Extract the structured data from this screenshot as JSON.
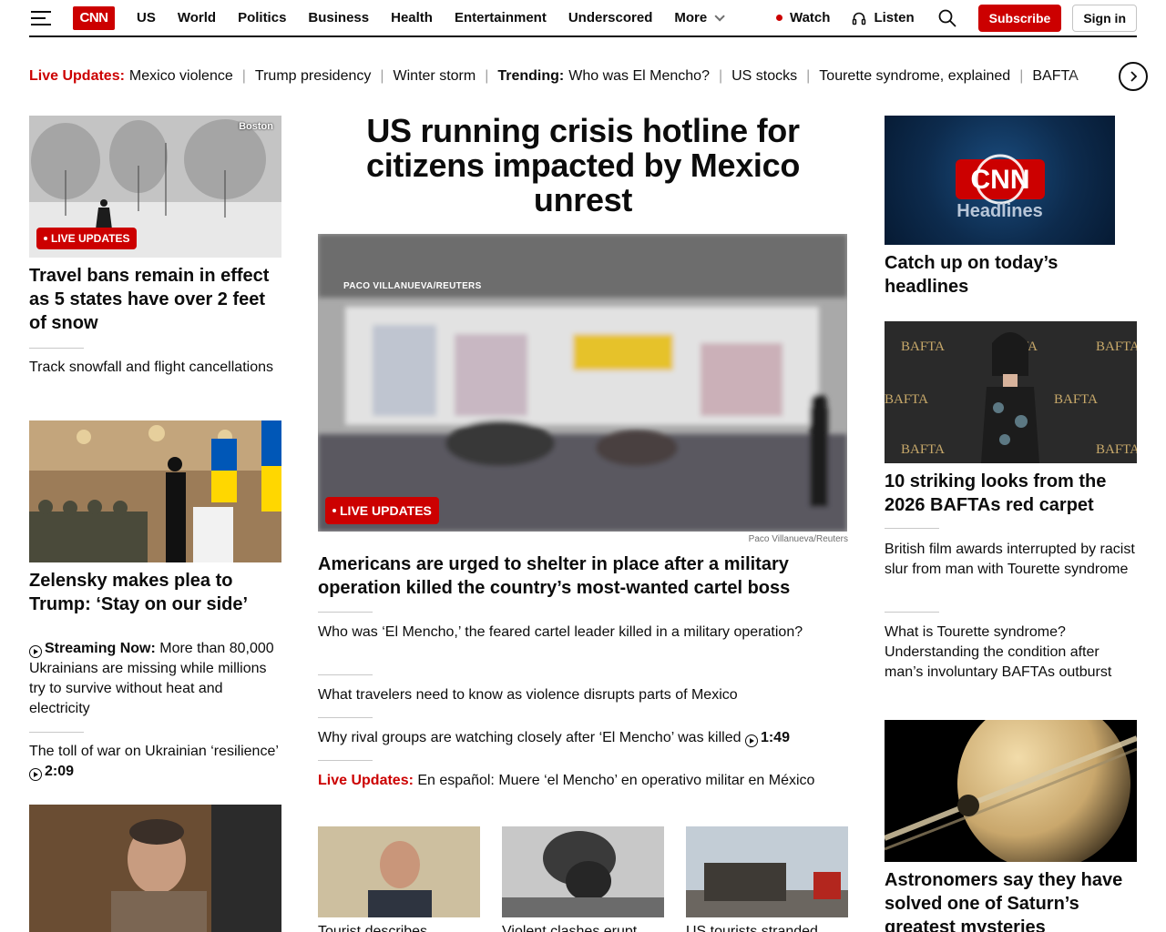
{
  "header": {
    "logo": "CNN",
    "nav": [
      "US",
      "World",
      "Politics",
      "Business",
      "Health",
      "Entertainment",
      "Underscored",
      "More"
    ],
    "watch": "Watch",
    "listen": "Listen",
    "subscribe": "Subscribe",
    "signin": "Sign in"
  },
  "ticker": [
    {
      "label": "Live Updates:",
      "label_style": "red",
      "text": "Mexico violence"
    },
    {
      "text": "Trump presidency"
    },
    {
      "text": "Winter storm"
    },
    {
      "label": "Trending:",
      "label_style": "bold",
      "text": "Who was El Mencho?"
    },
    {
      "text": "US stocks"
    },
    {
      "text": "Tourette syndrome, explained"
    },
    {
      "text": "BAFTA"
    }
  ],
  "left_col": {
    "storm": {
      "image_tag": "Boston",
      "badge": "LIVE UPDATES",
      "headline": "Travel bans remain in effect as 5 states have over 2 feet of snow",
      "sublink": "Track snowfall and flight cancellations"
    },
    "zelensky": {
      "headline": "Zelensky makes plea to Trump: ‘Stay on our side’",
      "stream_label": "Streaming Now:",
      "stream_text": " More than 80,000 Ukrainians are missing while millions try to survive without heat and electricity",
      "sublink": "The toll of war on Ukrainian ‘resilience’ ",
      "duration": "2:09"
    }
  },
  "main": {
    "headline": "US running crisis hotline for citizens impacted by Mexico unrest",
    "image_credit_overlay": "PACO VILLANUEVA/REUTERS",
    "badge": "LIVE UPDATES",
    "image_credit": "Paco Villanueva/Reuters",
    "subhead": "Americans are urged to shelter in place after a military operation killed the country’s most-wanted cartel boss",
    "links": [
      "Who was ‘El Mencho,’ the feared cartel leader killed in a military operation?",
      "What travelers need to know as violence disrupts parts of Mexico"
    ],
    "video_link": "Why rival groups are watching closely after ‘El Mencho’ was killed ",
    "video_duration": "1:49",
    "live_label": "Live Updates:",
    "live_text": " En español: Muere ‘el Mencho’ en operativo militar en México",
    "thumbs": [
      "Tourist describes",
      "Violent clashes erupt",
      "US tourists stranded"
    ]
  },
  "right_col": {
    "headlines_label": "Headlines",
    "headlines_caption": "Catch up on today’s headlines",
    "bafta_headline": "10 striking looks from the 2026 BAFTAs red carpet",
    "bafta_links": [
      "British film awards interrupted by racist slur from man with Tourette syndrome",
      "What is Tourette syndrome? Understanding the condition after man’s involuntary BAFTAs outburst"
    ],
    "bafta_backdrop": "BAFTA",
    "saturn_headline": "Astronomers say they have solved one of Saturn’s greatest mysteries"
  },
  "colors": {
    "brand": "#cc0000",
    "text": "#0c0c0c",
    "divider": "#c8c8c8"
  }
}
